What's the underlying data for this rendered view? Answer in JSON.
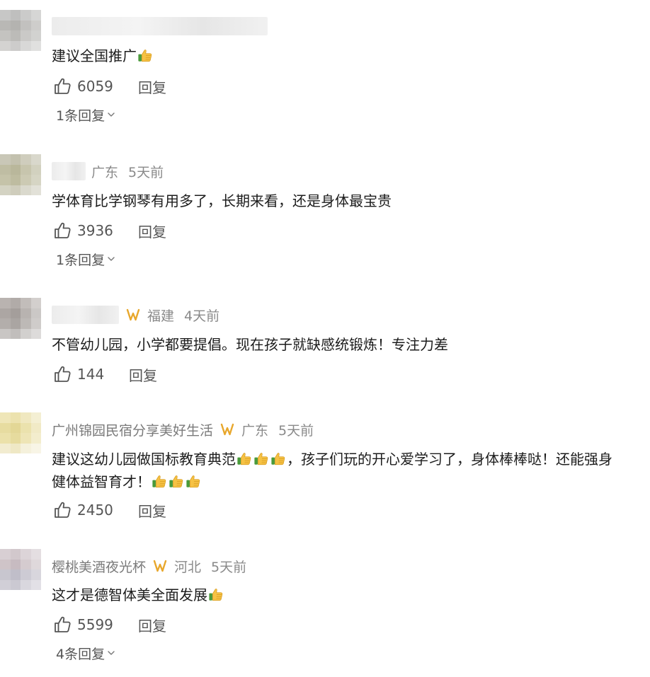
{
  "comments": [
    {
      "username": "",
      "location": "",
      "time": "",
      "text": "建议全国推广",
      "thumbs_after": 1,
      "likes": "6059",
      "reply_label": "回复",
      "expand_label": "1条回复"
    },
    {
      "username": "",
      "location": "广东",
      "time": "5天前",
      "text": "学体育比学钢琴有用多了，长期来看，还是身体最宝贵",
      "thumbs_after": 0,
      "likes": "3936",
      "reply_label": "回复",
      "expand_label": "1条回复"
    },
    {
      "username": "",
      "location": "福建",
      "time": "4天前",
      "text": "不管幼儿园，小学都要提倡。现在孩子就缺感统锻炼！专注力差",
      "thumbs_after": 0,
      "likes": "144",
      "reply_label": "回复",
      "expand_label": ""
    },
    {
      "username": "广州锦园民宿分享美好生活",
      "location": "广东",
      "time": "5天前",
      "text_part1": "建议这幼儿园做国标教育典范",
      "text_part2": "，孩子们玩的开心爱学习了，身体棒棒哒！还能强身",
      "text_part3": "健体益智育才！",
      "likes": "2450",
      "reply_label": "回复",
      "expand_label": ""
    },
    {
      "username": "樱桃美酒夜光杯",
      "location": "河北",
      "time": "5天前",
      "text": "这才是德智体美全面发展",
      "thumbs_after": 1,
      "likes": "5599",
      "reply_label": "回复",
      "expand_label": "4条回复"
    }
  ],
  "colors": {
    "text": "#1c1c1c",
    "meta": "#8a8a8a",
    "action": "#555555",
    "vip_gold": "#e8a72c"
  },
  "icons": {
    "like": "thumb-up-outline-icon",
    "vip": "vip-badge-icon",
    "emoji": "thumbs-up-emoji",
    "expand": "chevron-down-icon"
  }
}
